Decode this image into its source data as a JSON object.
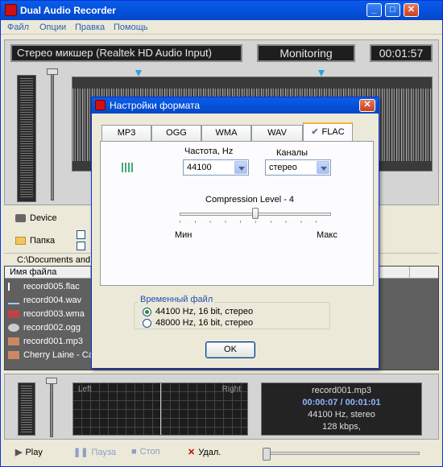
{
  "window": {
    "title": "Dual Audio Recorder"
  },
  "menu": [
    "Файл",
    "Опции",
    "Правка",
    "Помощь"
  ],
  "top": {
    "device": "Стерео микшер (Realtek HD Audio Input)",
    "mode": "Monitoring",
    "timer": "00:01:57"
  },
  "nav": {
    "device": "Device",
    "folder": "Папка"
  },
  "path": "C:\\Documents and",
  "files": {
    "header": "Имя файла",
    "rows": [
      "record005.flac",
      "record004.wav",
      "record003.wma",
      "record002.ogg",
      "record001.mp3",
      "Cherry Laine - Ca"
    ]
  },
  "meter": {
    "left": "Left",
    "right": "Right"
  },
  "info": {
    "file": "record001.mp3",
    "time": "00:00:07 / 00:01:01",
    "format": "44100 Hz, stereo",
    "bitrate": "128 kbps,"
  },
  "controls": {
    "play": "Play",
    "pause": "Пауза",
    "stop": "Стоп",
    "delete": "Удал."
  },
  "dialog": {
    "title": "Настройки формата",
    "tabs": [
      "MP3",
      "OGG",
      "WMA",
      "WAV",
      "FLAC"
    ],
    "active_tab": "FLAC",
    "freq_label": "Частота, Hz",
    "freq_value": "44100",
    "channels_label": "Каналы",
    "channels_value": "стерео",
    "compression_label": "Compression Level - 4",
    "compression_level": 4,
    "min_label": "Мин",
    "max_label": "Макс",
    "temp_title": "Временный файл",
    "temp_options": [
      "44100 Hz, 16 bit, стерео",
      "48000 Hz, 16 bit, стерео"
    ],
    "ok": "OK"
  }
}
